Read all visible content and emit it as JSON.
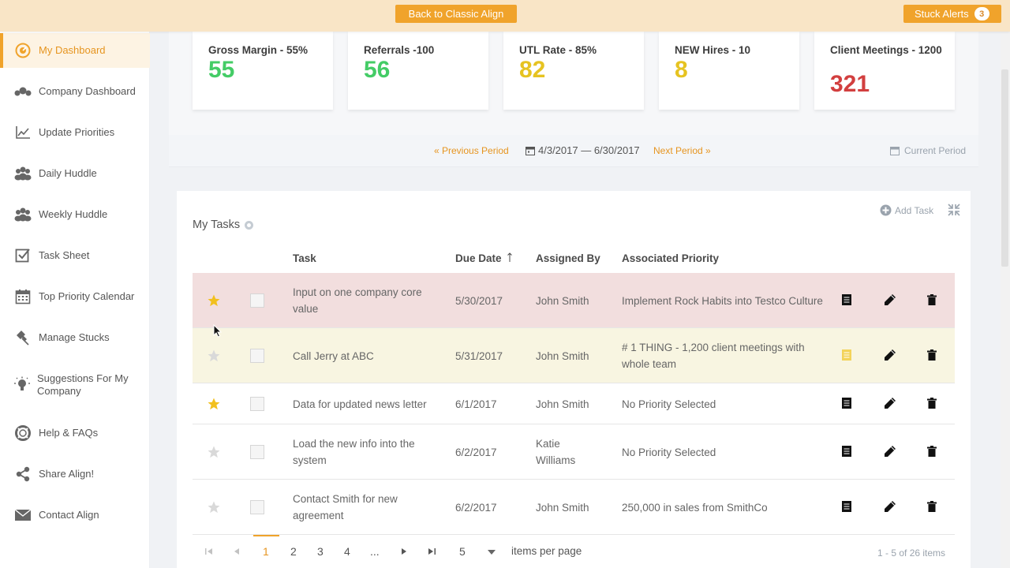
{
  "topbar": {
    "classic_button": "Back to Classic Align",
    "stuck_label": "Stuck Alerts",
    "stuck_count": "3"
  },
  "sidebar": {
    "items": [
      {
        "label": "My Dashboard",
        "icon": "dashboard-icon"
      },
      {
        "label": "Company Dashboard",
        "icon": "company-icon"
      },
      {
        "label": "Update Priorities",
        "icon": "chart-line-icon"
      },
      {
        "label": "Daily Huddle",
        "icon": "users-icon"
      },
      {
        "label": "Weekly Huddle",
        "icon": "users-icon"
      },
      {
        "label": "Task Sheet",
        "icon": "checklist-icon"
      },
      {
        "label": "Top Priority Calendar",
        "icon": "calendar-icon"
      },
      {
        "label": "Manage Stucks",
        "icon": "pin-icon"
      },
      {
        "label": "Suggestions For My Company",
        "icon": "lightbulb-icon"
      },
      {
        "label": "Help & FAQs",
        "icon": "lifebuoy-icon"
      },
      {
        "label": "Share Align!",
        "icon": "share-icon"
      },
      {
        "label": "Contact Align",
        "icon": "envelope-icon"
      }
    ]
  },
  "kpis": [
    {
      "title": "Gross Margin - 55%",
      "value": "55",
      "color": "#44cc66"
    },
    {
      "title": "Referrals -100",
      "value": "56",
      "color": "#44cc66"
    },
    {
      "title": "UTL Rate - 85%",
      "value": "82",
      "color": "#e6c321"
    },
    {
      "title": "NEW Hires - 10",
      "value": "8",
      "color": "#e6c321"
    },
    {
      "title": "Client Meetings - 1200",
      "value": "321",
      "color": "#d23f3f"
    }
  ],
  "period": {
    "previous": "« Previous Period",
    "range": "4/3/2017 — 6/30/2017",
    "next": "Next Period »",
    "current": "Current Period"
  },
  "tasks": {
    "title": "My Tasks",
    "add_task": "Add Task",
    "columns": {
      "task": "Task",
      "due_date": "Due Date",
      "assigned_by": "Assigned By",
      "priority": "Associated Priority"
    },
    "rows": [
      {
        "task": "Input on one company core value",
        "due": "5/30/2017",
        "assigned": "John Smith",
        "priority": "Implement Rock Habits into Testco Culture",
        "starred": true,
        "bg": "#f2dede"
      },
      {
        "task": "Call Jerry at ABC",
        "due": "5/31/2017",
        "assigned": "John Smith",
        "priority": "# 1 THING - 1,200 client meetings with whole team",
        "starred": false,
        "bg": "#f8f5e1"
      },
      {
        "task": "Data for updated news letter",
        "due": "6/1/2017",
        "assigned": "John Smith",
        "priority": "No Priority Selected",
        "starred": true,
        "bg": "#ffffff"
      },
      {
        "task": "Load the new info into the system",
        "due": "6/2/2017",
        "assigned": "Katie Williams",
        "priority": "No Priority Selected",
        "starred": false,
        "bg": "#ffffff"
      },
      {
        "task": "Contact Smith for new agreement",
        "due": "6/2/2017",
        "assigned": "John Smith",
        "priority": "250,000 in sales from SmithCo",
        "starred": false,
        "bg": "#ffffff"
      }
    ]
  },
  "pagination": {
    "pages": [
      "1",
      "2",
      "3",
      "4",
      "..."
    ],
    "current_page": "1",
    "per_page": "5",
    "per_page_label": "items per page",
    "range": "1 - 5 of 26 items"
  }
}
